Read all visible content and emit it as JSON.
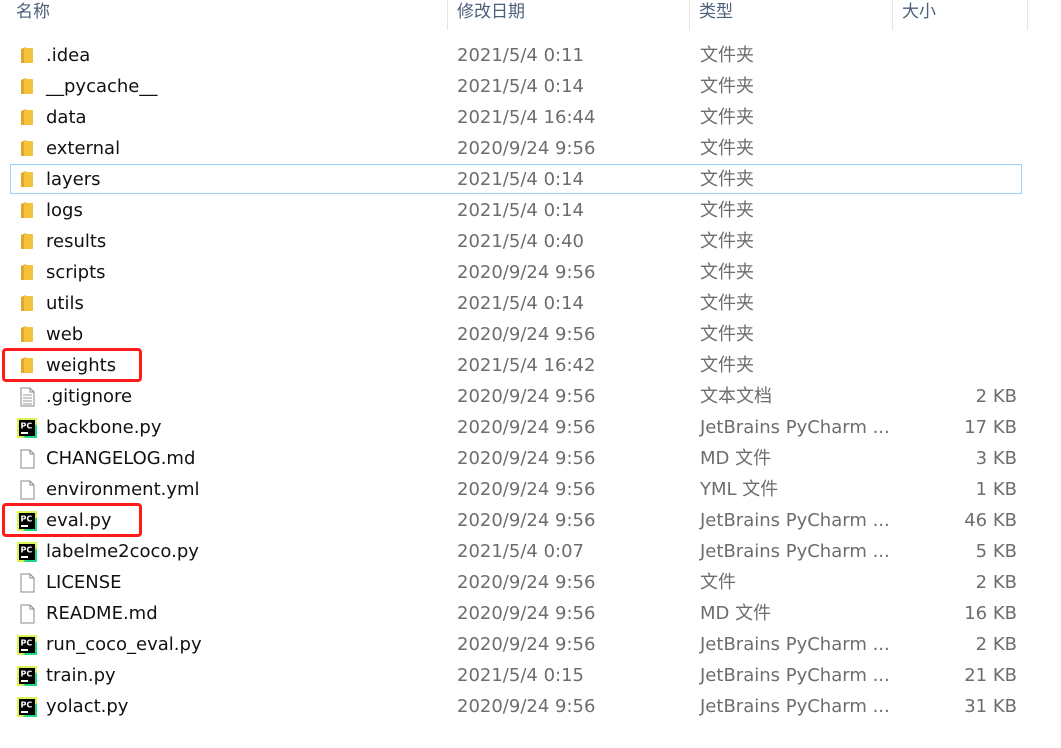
{
  "columns": {
    "name": "名称",
    "date": "修改日期",
    "type": "类型",
    "size": "大小"
  },
  "files": [
    {
      "name": ".idea",
      "date": "2021/5/4 0:11",
      "type": "文件夹",
      "size": "",
      "icon": "folder-icon"
    },
    {
      "name": "__pycache__",
      "date": "2021/5/4 0:14",
      "type": "文件夹",
      "size": "",
      "icon": "folder-icon"
    },
    {
      "name": "data",
      "date": "2021/5/4 16:44",
      "type": "文件夹",
      "size": "",
      "icon": "folder-icon"
    },
    {
      "name": "external",
      "date": "2020/9/24 9:56",
      "type": "文件夹",
      "size": "",
      "icon": "folder-icon"
    },
    {
      "name": "layers",
      "date": "2021/5/4 0:14",
      "type": "文件夹",
      "size": "",
      "icon": "folder-icon",
      "selected": true
    },
    {
      "name": "logs",
      "date": "2021/5/4 0:14",
      "type": "文件夹",
      "size": "",
      "icon": "folder-icon"
    },
    {
      "name": "results",
      "date": "2021/5/4 0:40",
      "type": "文件夹",
      "size": "",
      "icon": "folder-icon"
    },
    {
      "name": "scripts",
      "date": "2020/9/24 9:56",
      "type": "文件夹",
      "size": "",
      "icon": "folder-icon"
    },
    {
      "name": "utils",
      "date": "2021/5/4 0:14",
      "type": "文件夹",
      "size": "",
      "icon": "folder-icon"
    },
    {
      "name": "web",
      "date": "2020/9/24 9:56",
      "type": "文件夹",
      "size": "",
      "icon": "folder-icon"
    },
    {
      "name": "weights",
      "date": "2021/5/4 16:42",
      "type": "文件夹",
      "size": "",
      "icon": "folder-icon",
      "annotated": true
    },
    {
      "name": ".gitignore",
      "date": "2020/9/24 9:56",
      "type": "文本文档",
      "size": "2 KB",
      "icon": "text-document-icon"
    },
    {
      "name": "backbone.py",
      "date": "2020/9/24 9:56",
      "type": "JetBrains PyCharm ...",
      "size": "17 KB",
      "icon": "pycharm-file-icon"
    },
    {
      "name": "CHANGELOG.md",
      "date": "2020/9/24 9:56",
      "type": "MD 文件",
      "size": "3 KB",
      "icon": "blank-file-icon"
    },
    {
      "name": "environment.yml",
      "date": "2020/9/24 9:56",
      "type": "YML 文件",
      "size": "1 KB",
      "icon": "blank-file-icon"
    },
    {
      "name": "eval.py",
      "date": "2020/9/24 9:56",
      "type": "JetBrains PyCharm ...",
      "size": "46 KB",
      "icon": "pycharm-file-icon",
      "annotated": true
    },
    {
      "name": "labelme2coco.py",
      "date": "2021/5/4 0:07",
      "type": "JetBrains PyCharm ...",
      "size": "5 KB",
      "icon": "pycharm-file-icon"
    },
    {
      "name": "LICENSE",
      "date": "2020/9/24 9:56",
      "type": "文件",
      "size": "2 KB",
      "icon": "blank-file-icon"
    },
    {
      "name": "README.md",
      "date": "2020/9/24 9:56",
      "type": "MD 文件",
      "size": "16 KB",
      "icon": "blank-file-icon"
    },
    {
      "name": "run_coco_eval.py",
      "date": "2020/9/24 9:56",
      "type": "JetBrains PyCharm ...",
      "size": "2 KB",
      "icon": "pycharm-file-icon"
    },
    {
      "name": "train.py",
      "date": "2021/5/4 0:15",
      "type": "JetBrains PyCharm ...",
      "size": "21 KB",
      "icon": "pycharm-file-icon"
    },
    {
      "name": "yolact.py",
      "date": "2020/9/24 9:56",
      "type": "JetBrains PyCharm ...",
      "size": "31 KB",
      "icon": "pycharm-file-icon"
    }
  ],
  "pycharm_icon_text": "PC",
  "colors": {
    "folder": "#f4c23d",
    "selection_border": "#99d1ff",
    "annotation": "#ff1a1a",
    "pycharm_bg": "#000000",
    "pycharm_accent": "#21d789"
  }
}
